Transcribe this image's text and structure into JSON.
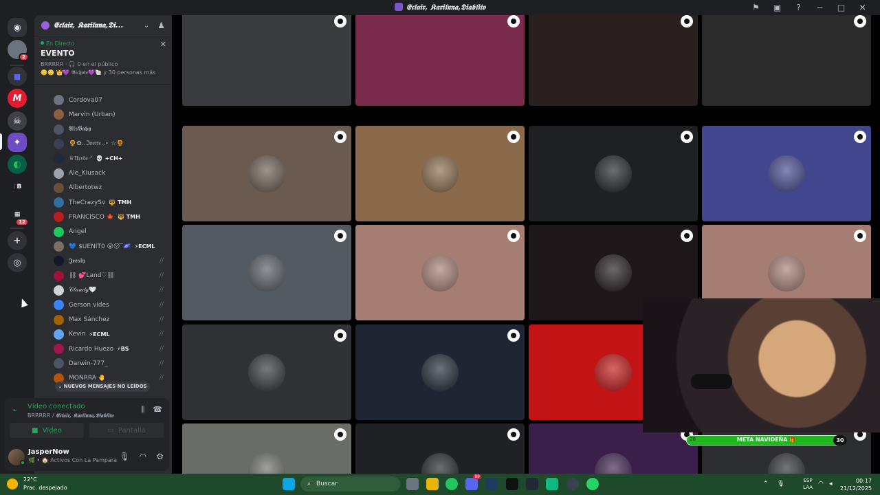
{
  "window": {
    "title": "𝕰𝖈𝖑𝖆𝖎𝖗, 𝕶𝖆𝖗𝖎𝖑𝖚𝖓𝖆,𝕯𝖎𝖆𝖇𝖑𝖎𝖙𝖔"
  },
  "server": {
    "name": "𝕰𝖈𝖑𝖆𝖎𝖗, 𝕶𝖆𝖗𝖎𝖑𝖚𝖓𝖆,𝕯𝖎..."
  },
  "rail": {
    "badges": [
      "2",
      "12"
    ]
  },
  "event": {
    "status": "En Directo",
    "name": "EVENTO",
    "host_line": "BRRRRR · 🎧 0 en el público",
    "attendees": "🙂🙂 👑💜 𝕭𝖎𝖈𝖍𝖔𝖙𝖊💜🐚 y 30 personas más"
  },
  "users": [
    {
      "name": "Cordova07",
      "tag": "",
      "muted": false,
      "color": "#6b7280"
    },
    {
      "name": "Marvin (Urban)",
      "tag": "",
      "muted": false,
      "color": "#8b5e3c"
    },
    {
      "name": "𝕬𝖑𝖘𝕭𝖆𝖇𝖞",
      "tag": "",
      "muted": false,
      "color": "#4b5563"
    },
    {
      "name": "🌻✿..ℑ𝔳𝔢𝔱𝔱𝔢..⋆ ☆🌻",
      "tag": "",
      "muted": false,
      "color": "#374151"
    },
    {
      "name": "♕𝔘𝔯𝔵𝔟𝔢·ᐟ",
      "tag": "💀 +CH+",
      "muted": false,
      "color": "#1f2937"
    },
    {
      "name": "Ale_Kiusack",
      "tag": "",
      "muted": false,
      "color": "#9ca3af"
    },
    {
      "name": "Albertotwz",
      "tag": "",
      "muted": false,
      "color": "#6b4f3a"
    },
    {
      "name": "TheCrazySv",
      "tag": "🔱 TMH",
      "muted": false,
      "color": "#2f6f9f"
    },
    {
      "name": "FRANCISCO 🍁",
      "tag": "🔱 TMH",
      "muted": false,
      "color": "#b91c1c"
    },
    {
      "name": "Angel",
      "tag": "",
      "muted": false,
      "color": "#22c55e"
    },
    {
      "name": "💙 $UEÑIT0 😵😴🌌",
      "tag": "⚡ECML",
      "muted": false,
      "color": "#7c6f64"
    },
    {
      "name": "𝕵𝖊𝖊𝖘𝖑𝖞",
      "tag": "",
      "muted": true,
      "color": "#111827"
    },
    {
      "name": "⛓ 💕Land♡⛓",
      "tag": "",
      "muted": true,
      "color": "#9f1239"
    },
    {
      "name": "𝒞𝓁𝒶𝓊𝒹𝓎🤍",
      "tag": "",
      "muted": true,
      "color": "#d1d5db"
    },
    {
      "name": "Gerson vides",
      "tag": "",
      "muted": true,
      "color": "#3b82f6"
    },
    {
      "name": "Max Sánchez",
      "tag": "",
      "muted": true,
      "color": "#a16207"
    },
    {
      "name": "Kevin",
      "tag": "⚡ECML",
      "muted": true,
      "color": "#60a5fa"
    },
    {
      "name": "Ricardo Huezo",
      "tag": "⚡BS",
      "muted": true,
      "color": "#9d174d"
    },
    {
      "name": "Darwin-777_",
      "tag": "",
      "muted": true,
      "color": "#4b5563"
    },
    {
      "name": "MONRRA 🤚",
      "tag": "",
      "muted": true,
      "color": "#b45309"
    }
  ],
  "new_messages_label": "⌄ NUEVOS MENSAJES NO LEÍDOS",
  "voice": {
    "status": "Vídeo conectado",
    "location_prefix": "BRRRRR / ",
    "location_server": "𝕰𝖈𝖑𝖆𝖎𝖗, 𝕶𝖆𝖗𝖎𝖑𝖚𝖓𝖆,𝕯𝖎𝖆𝖇𝖑𝖎𝖙𝖔",
    "video_label": "Vídeo",
    "screen_label": "Pantalla"
  },
  "user": {
    "name": "JasperNow",
    "status": "🌿 • 🏠 Activos Con La Pampara"
  },
  "stage": {
    "tile_colors": [
      "#3a3b3f",
      "#7a2a4a",
      "#2a2020",
      "#2b2b2b",
      "#6a5a50",
      "#8a6a4a",
      "#1f2022",
      "#42468f",
      "#545a62",
      "#a57d72",
      "#1e1719",
      "#a57d72",
      "#303236",
      "#1f2532",
      "#c21414",
      "#2d2f33",
      "#6b6d69",
      "#202124",
      "#3a1f4a",
      "#2b2d31"
    ],
    "meta_goal": {
      "left": "28",
      "label": "META NAVIDEÑA 🎁",
      "right": "30"
    }
  },
  "taskbar": {
    "temp": "22°C",
    "condition": "Prac. despejado",
    "search": "Buscar",
    "lang_top": "ESP",
    "lang_bottom": "LAA",
    "time": "00:17",
    "date": "21/12/2025",
    "app_badge": "99"
  }
}
